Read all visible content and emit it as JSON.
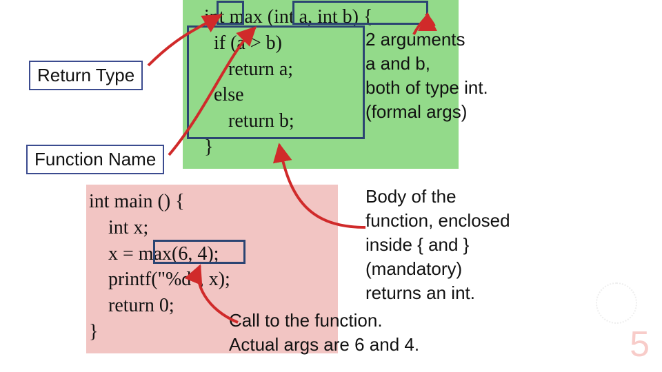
{
  "labels": {
    "return_type": "Return Type",
    "function_name": "Function Name",
    "args": {
      "l1": "2 arguments",
      "l2": "a and b,",
      "l3": "both of type int.",
      "l4": "(formal args)"
    },
    "body": {
      "l1": "Body of the",
      "l2": "function, enclosed",
      "l3": "inside { and }",
      "l4": "(mandatory)",
      "l5": "returns an int."
    },
    "call": {
      "l1": "Call to the function.",
      "l2": "Actual args are 6 and 4."
    }
  },
  "code_top": {
    "l1a": "   int ",
    "l1b": "max ",
    "l1c": "(int a, int b) {",
    "l2": "     if (a > b)",
    "l3": "        return a;",
    "l4": "     else",
    "l5": "        return b;",
    "l6": "   }"
  },
  "code_bottom": {
    "l1": "int main () {",
    "l2": "    int x;",
    "l3": "    x = max(6, 4);",
    "l4": "    printf(\"%d\", x);",
    "l5": "    return 0;",
    "l6": "}"
  },
  "footer": {
    "page_number": "5"
  },
  "colors": {
    "arrow_red": "#d02a2a",
    "box_blue": "#2b4472",
    "green_bg": "#93da8a",
    "pink_bg": "#f2c5c3"
  }
}
